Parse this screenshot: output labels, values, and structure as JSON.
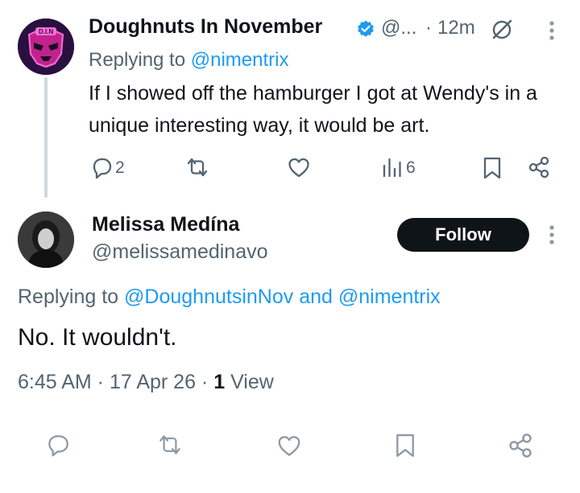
{
  "tweet1": {
    "display_name": "Doughnuts In November",
    "handle_trunc": "@...",
    "separator": "·",
    "time_ago": "12m",
    "replying_label": "Replying to",
    "replying_handle": "@nimentrix",
    "text": "If I showed off the hamburger I got at Wendy's in a unique interesting way, it would be art.",
    "avatar_text": "D.I.N",
    "actions": {
      "replies": "2",
      "retweets": "",
      "likes": "",
      "views": "6"
    }
  },
  "tweet2": {
    "display_name": "Melissa Medína",
    "handle": "@melissamedinavo",
    "follow_label": "Follow",
    "replying_label": "Replying to",
    "replying_handle1": "@DoughnutsinNov",
    "replying_and": "and",
    "replying_handle2": "@nimentrix",
    "text": "No. It wouldn't.",
    "timestamp": "6:45 AM · 17 Apr 26 ·",
    "views_count": "1",
    "views_label": "View"
  },
  "colors": {
    "text": "#0f1419",
    "muted": "#536471",
    "link": "#1d9bf0",
    "verified": "#1d9bf0",
    "thread_line": "#cfd9de",
    "follow_bg": "#0f1419"
  },
  "icons": [
    "reply-icon",
    "retweet-icon",
    "like-icon",
    "views-icon",
    "bookmark-icon",
    "share-icon",
    "grok-icon",
    "more-icon",
    "verified-badge-icon"
  ]
}
